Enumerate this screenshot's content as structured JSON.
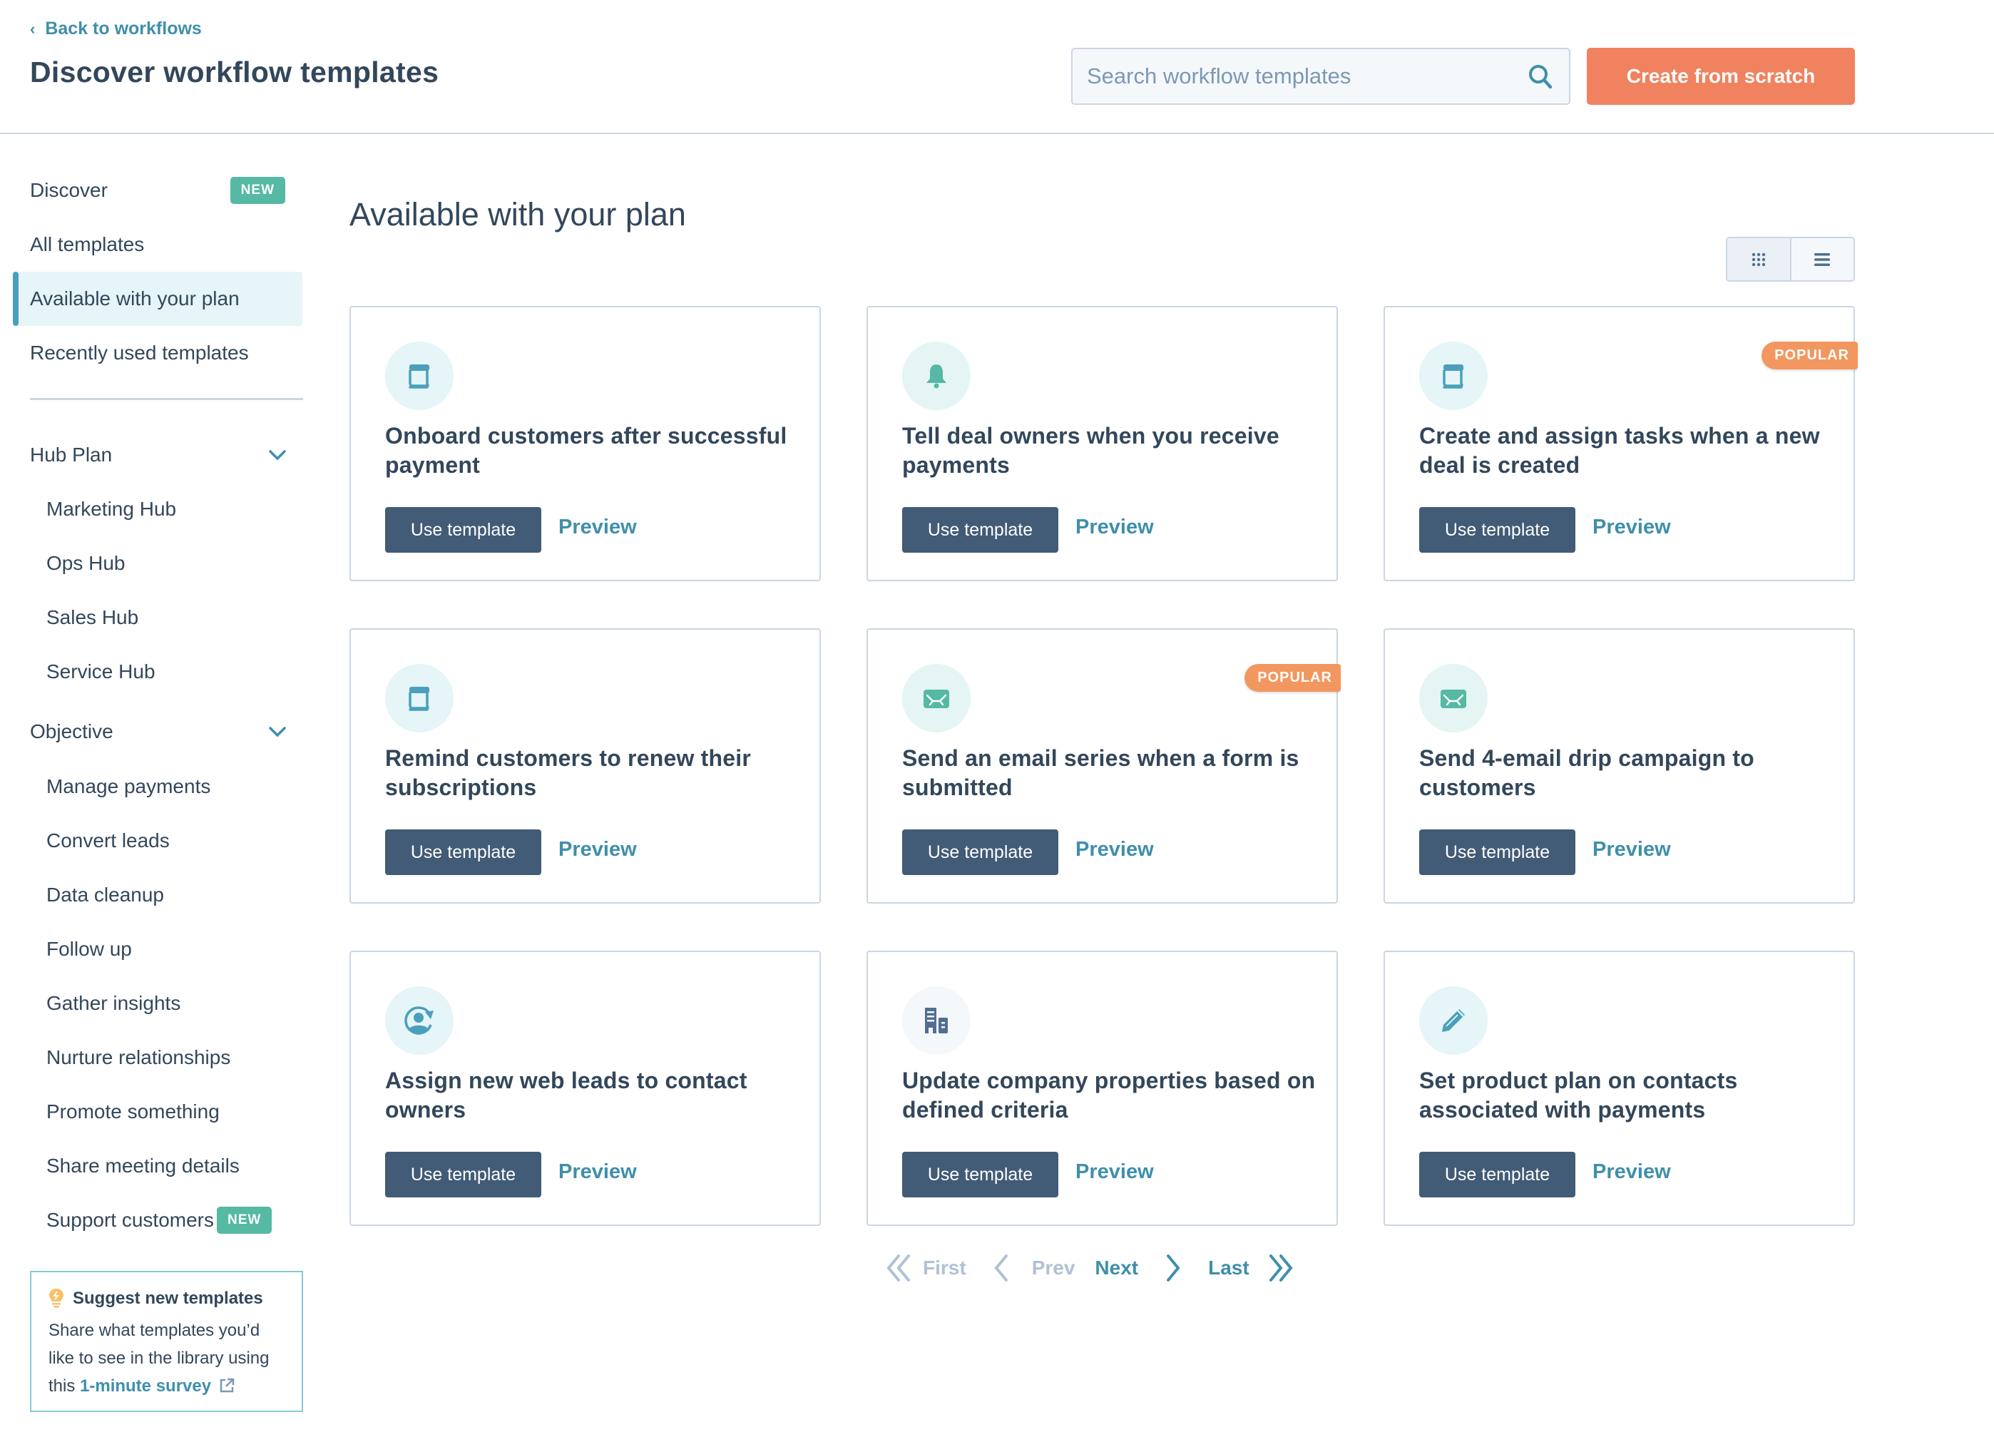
{
  "header": {
    "back_link": "Back to workflows",
    "title": "Discover workflow templates",
    "search_placeholder": "Search workflow templates",
    "search_value": "",
    "create_button": "Create from scratch"
  },
  "sidebar": {
    "primary": [
      {
        "label": "Discover",
        "badge": "NEW",
        "active": false
      },
      {
        "label": "All templates",
        "active": false
      },
      {
        "label": "Available with your plan",
        "active": true
      },
      {
        "label": "Recently used templates",
        "active": false
      }
    ],
    "hub_plan": {
      "label": "Hub Plan",
      "items": [
        "Marketing Hub",
        "Ops Hub",
        "Sales Hub",
        "Service Hub"
      ]
    },
    "objective": {
      "label": "Objective",
      "items": [
        {
          "label": "Manage payments"
        },
        {
          "label": "Convert leads"
        },
        {
          "label": "Data cleanup"
        },
        {
          "label": "Follow up"
        },
        {
          "label": "Gather insights"
        },
        {
          "label": "Nurture relationships"
        },
        {
          "label": "Promote something"
        },
        {
          "label": "Share meeting details"
        },
        {
          "label": "Support customers",
          "badge": "NEW"
        }
      ]
    },
    "suggest": {
      "title": "Suggest new templates",
      "text_before": "Share what templates you’d like to see in the library using this ",
      "link": "1-minute survey"
    }
  },
  "main": {
    "title": "Available with your plan",
    "view_toggle": {
      "grid": "grid-view-icon",
      "list": "list-view-icon",
      "active": "grid"
    },
    "use_label": "Use template",
    "preview_label": "Preview",
    "popular_label": "POPULAR",
    "cards": [
      {
        "title": "Onboard customers after successful payment",
        "icon": "invoice",
        "popular": false
      },
      {
        "title": "Tell deal owners when you receive payments",
        "icon": "bell",
        "popular": false
      },
      {
        "title": "Create and assign tasks when a new deal is created",
        "icon": "invoice",
        "popular": true
      },
      {
        "title": "Remind customers to renew their subscriptions",
        "icon": "invoice",
        "popular": false
      },
      {
        "title": "Send an email series when a form is submitted",
        "icon": "email",
        "popular": true
      },
      {
        "title": "Send 4-email drip campaign to customers",
        "icon": "email",
        "popular": false
      },
      {
        "title": "Assign new web leads to contact owners",
        "icon": "contact-rotate",
        "popular": false
      },
      {
        "title": "Update company properties based on defined criteria",
        "icon": "building",
        "popular": false
      },
      {
        "title": "Set product plan on contacts associated with payments",
        "icon": "pencil",
        "popular": false
      }
    ],
    "pagination": {
      "first": "First",
      "prev": "Prev",
      "next": "Next",
      "last": "Last"
    }
  },
  "colors": {
    "accent": "#3f8fab",
    "primary_button": "#425b76",
    "create_button": "#f0825f",
    "popular_badge": "#f2975f",
    "new_badge": "#55b9a3",
    "text": "#33475b"
  }
}
